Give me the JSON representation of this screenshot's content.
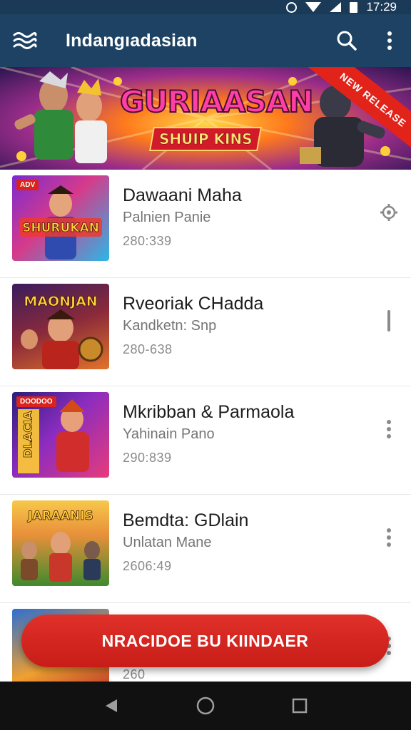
{
  "status_bar": {
    "time": "17:29",
    "icons": [
      "alarm-icon",
      "wifi-icon",
      "signal-icon",
      "battery-icon"
    ]
  },
  "app_bar": {
    "title": "Indangıadasian",
    "menu_icon": "waves-logo-icon",
    "actions": [
      "search-icon",
      "more-vert-icon"
    ]
  },
  "banner": {
    "title": "GURIAASAN",
    "subtitle": "SHUIP KINS",
    "ribbon": "NEW RELEASE"
  },
  "games": [
    {
      "title": "Dawaani Maha",
      "subtitle": "Palnien Panie",
      "count": "280:339",
      "thumb_label": "SHURUKAN",
      "thumb_tag": "ADV",
      "action_icon": "settings-gear-icon",
      "colors": [
        "#7a2bd1",
        "#f0382d",
        "#2bb7e6"
      ]
    },
    {
      "title": "Rveoriak CHadda",
      "subtitle": "Kandketn: Snp",
      "count": "280-638",
      "thumb_label": "MAONJAN",
      "thumb_tag": "",
      "action_icon": "drag-handle-icon",
      "colors": [
        "#3a1c5e",
        "#e2732a",
        "#b9251c"
      ]
    },
    {
      "title": "Mkribban & Parmaola",
      "subtitle": "Yahinain Pano",
      "count": "290:839",
      "thumb_label": "DLACIA",
      "thumb_tag": "DOODOO",
      "action_icon": "more-vert-icon",
      "colors": [
        "#2a1f7a",
        "#e83b7a",
        "#ffcc33"
      ]
    },
    {
      "title": "Bemdta: GDlain",
      "subtitle": "Unlatan Mane",
      "count": "2606:49",
      "thumb_label": "JARAANIS",
      "thumb_tag": "",
      "action_icon": "more-vert-icon",
      "colors": [
        "#3f8a2d",
        "#f2b43a",
        "#c9362a"
      ]
    },
    {
      "title": "",
      "subtitle": "",
      "count": "260",
      "thumb_label": "",
      "thumb_tag": "",
      "action_icon": "more-vert-icon",
      "colors": [
        "#2f6fcf",
        "#f0a030",
        "#b82a2a"
      ]
    }
  ],
  "cta_button": {
    "label": "NRACIDOE BU KIINDAER"
  },
  "nav_bar": {
    "buttons": [
      "back-icon",
      "home-icon",
      "recents-icon"
    ]
  }
}
